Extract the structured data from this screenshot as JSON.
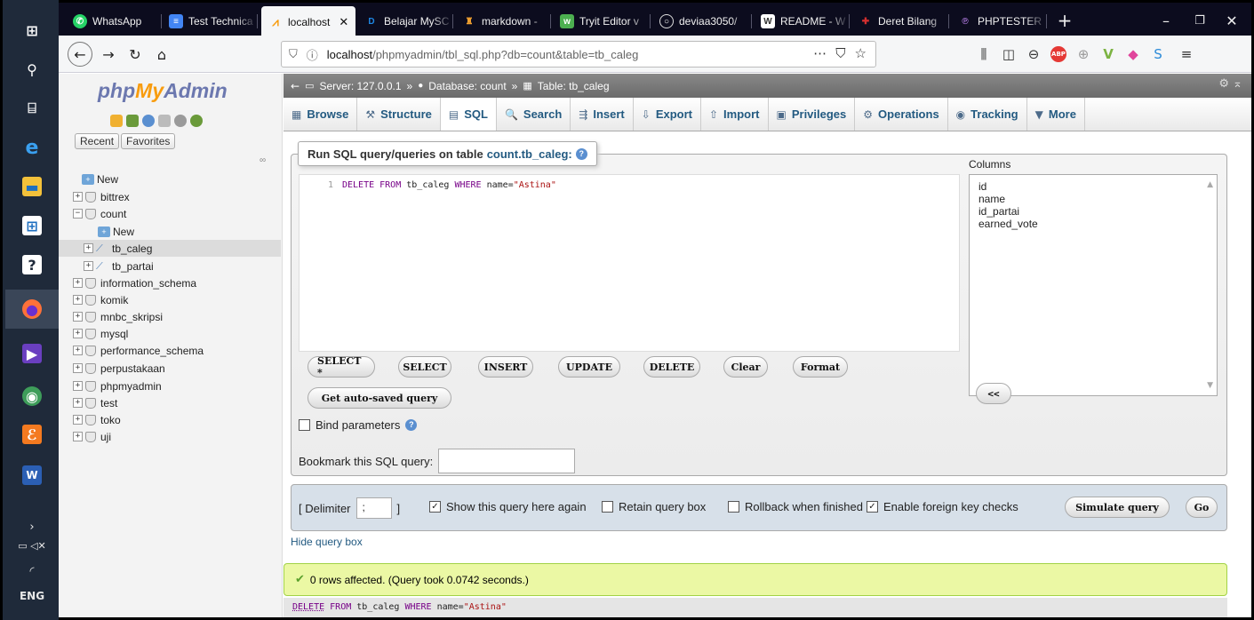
{
  "taskbar": {
    "tray_lang": "ENG"
  },
  "browser": {
    "tabs": [
      {
        "label": "WhatsApp",
        "color": "#25d366"
      },
      {
        "label": "Test Technica",
        "color": "#4285f4"
      },
      {
        "label": "localhost",
        "color": "#f89c0e",
        "active": true
      },
      {
        "label": "Belajar MySC",
        "color": "#1e88e5"
      },
      {
        "label": "markdown -",
        "color": "#f0a030"
      },
      {
        "label": "Tryit Editor v",
        "color": "#4caf50"
      },
      {
        "label": "deviaa3050/",
        "color": "#24292e"
      },
      {
        "label": "README - W",
        "color": "#333333"
      },
      {
        "label": "Deret Bilang",
        "color": "#d32f2f"
      },
      {
        "label": "PHPTESTER",
        "color": "#7b3f9e"
      }
    ],
    "url_host": "localhost",
    "url_rest": "/phpmyadmin/tbl_sql.php?db=count&table=tb_caleg"
  },
  "pma": {
    "logo_php": "php",
    "logo_my": "My",
    "logo_admin": "Admin",
    "recent": "Recent",
    "favorites": "Favorites",
    "tree": [
      {
        "label": "New",
        "type": "new",
        "depth": 0
      },
      {
        "label": "bittrex",
        "type": "db",
        "depth": 0
      },
      {
        "label": "count",
        "type": "db",
        "depth": 0,
        "expanded": true
      },
      {
        "label": "New",
        "type": "new",
        "depth": 1
      },
      {
        "label": "tb_caleg",
        "type": "table",
        "depth": 1,
        "selected": true
      },
      {
        "label": "tb_partai",
        "type": "table",
        "depth": 1
      },
      {
        "label": "information_schema",
        "type": "db",
        "depth": 0
      },
      {
        "label": "komik",
        "type": "db",
        "depth": 0
      },
      {
        "label": "mnbc_skripsi",
        "type": "db",
        "depth": 0
      },
      {
        "label": "mysql",
        "type": "db",
        "depth": 0
      },
      {
        "label": "performance_schema",
        "type": "db",
        "depth": 0
      },
      {
        "label": "perpustakaan",
        "type": "db",
        "depth": 0
      },
      {
        "label": "phpmyadmin",
        "type": "db",
        "depth": 0
      },
      {
        "label": "test",
        "type": "db",
        "depth": 0
      },
      {
        "label": "toko",
        "type": "db",
        "depth": 0
      },
      {
        "label": "uji",
        "type": "db",
        "depth": 0
      }
    ],
    "breadcrumb": {
      "server": "Server: 127.0.0.1",
      "database": "Database: count",
      "table": "Table: tb_caleg"
    },
    "menu": [
      {
        "label": "Browse",
        "icon": "▦"
      },
      {
        "label": "Structure",
        "icon": "⚒"
      },
      {
        "label": "SQL",
        "icon": "▤",
        "active": true
      },
      {
        "label": "Search",
        "icon": "🔍"
      },
      {
        "label": "Insert",
        "icon": "⇶"
      },
      {
        "label": "Export",
        "icon": "⇩"
      },
      {
        "label": "Import",
        "icon": "⇧"
      },
      {
        "label": "Privileges",
        "icon": "▣"
      },
      {
        "label": "Operations",
        "icon": "⚙"
      },
      {
        "label": "Tracking",
        "icon": "◉"
      },
      {
        "label": "More",
        "icon": "▼"
      }
    ],
    "legend_prefix": "Run SQL query/queries on table",
    "legend_table": "count.tb_caleg:",
    "editor": {
      "line": "1",
      "kw1": "DELETE FROM",
      "mid": " tb_caleg ",
      "kw2": "WHERE",
      "cond": " name=",
      "str": "\"Astina\""
    },
    "columns_label": "Columns",
    "columns": [
      "id",
      "name",
      "id_partai",
      "earned_vote"
    ],
    "buttons": {
      "select_star": "SELECT *",
      "select": "SELECT",
      "insert": "INSERT",
      "update": "UPDATE",
      "delete": "DELETE",
      "clear": "Clear",
      "format": "Format",
      "auto_saved": "Get auto-saved query",
      "insert_col": "<<",
      "simulate": "Simulate query",
      "go": "Go"
    },
    "bind_parameters": "Bind parameters",
    "bookmark_label": "Bookmark this SQL query:",
    "delimiter_label": "[ Delimiter",
    "delimiter_value": ";",
    "delimiter_close": "]",
    "options": {
      "show_again": "Show this query here again",
      "retain": "Retain query box",
      "rollback": "Rollback when finished",
      "foreign_keys": "Enable foreign key checks"
    },
    "hide_query": "Hide query box",
    "success": "0 rows affected. (Query took 0.0742 seconds.)",
    "result_sql": {
      "kw1": "DELETE",
      "kw2": "FROM",
      "mid": " tb_caleg ",
      "kw3": "WHERE",
      "cond": " name=",
      "str": "\"Astina\""
    }
  }
}
